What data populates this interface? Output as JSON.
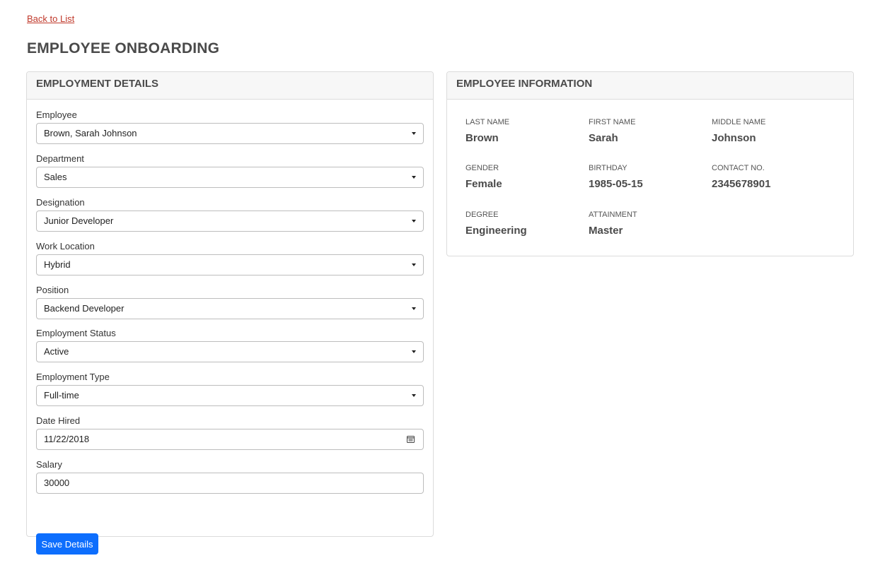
{
  "nav": {
    "back_label": "Back to List"
  },
  "page": {
    "title": "EMPLOYEE ONBOARDING"
  },
  "employment": {
    "header": "EMPLOYMENT DETAILS",
    "fields": [
      {
        "label": "Employee",
        "value": "Brown, Sarah Johnson",
        "type": "select"
      },
      {
        "label": "Department",
        "value": "Sales",
        "type": "select"
      },
      {
        "label": "Designation",
        "value": "Junior Developer",
        "type": "select"
      },
      {
        "label": "Work Location",
        "value": "Hybrid",
        "type": "select"
      },
      {
        "label": "Position",
        "value": "Backend Developer",
        "type": "select"
      },
      {
        "label": "Employment Status",
        "value": "Active",
        "type": "select"
      },
      {
        "label": "Employment Type",
        "value": "Full-time",
        "type": "select"
      },
      {
        "label": "Date Hired",
        "value": "11/22/2018",
        "type": "date"
      },
      {
        "label": "Salary",
        "value": "30000",
        "type": "text"
      }
    ],
    "save_label": "Save Details"
  },
  "info": {
    "header": "EMPLOYEE INFORMATION",
    "items": [
      {
        "label": "LAST NAME",
        "value": "Brown"
      },
      {
        "label": "FIRST NAME",
        "value": "Sarah"
      },
      {
        "label": "MIDDLE NAME",
        "value": "Johnson"
      },
      {
        "label": "GENDER",
        "value": "Female"
      },
      {
        "label": "BIRTHDAY",
        "value": "1985-05-15"
      },
      {
        "label": "CONTACT NO.",
        "value": "2345678901"
      },
      {
        "label": "DEGREE",
        "value": "Engineering"
      },
      {
        "label": "ATTAINMENT",
        "value": "Master"
      }
    ]
  },
  "colors": {
    "primary_button": "#0d6efd",
    "back_link": "#c0392b",
    "card_header_bg": "#f7f7f7",
    "border": "#dcdcdc"
  },
  "icons": {
    "select_caret": "chevron-down-icon",
    "date_picker": "calendar-icon"
  }
}
